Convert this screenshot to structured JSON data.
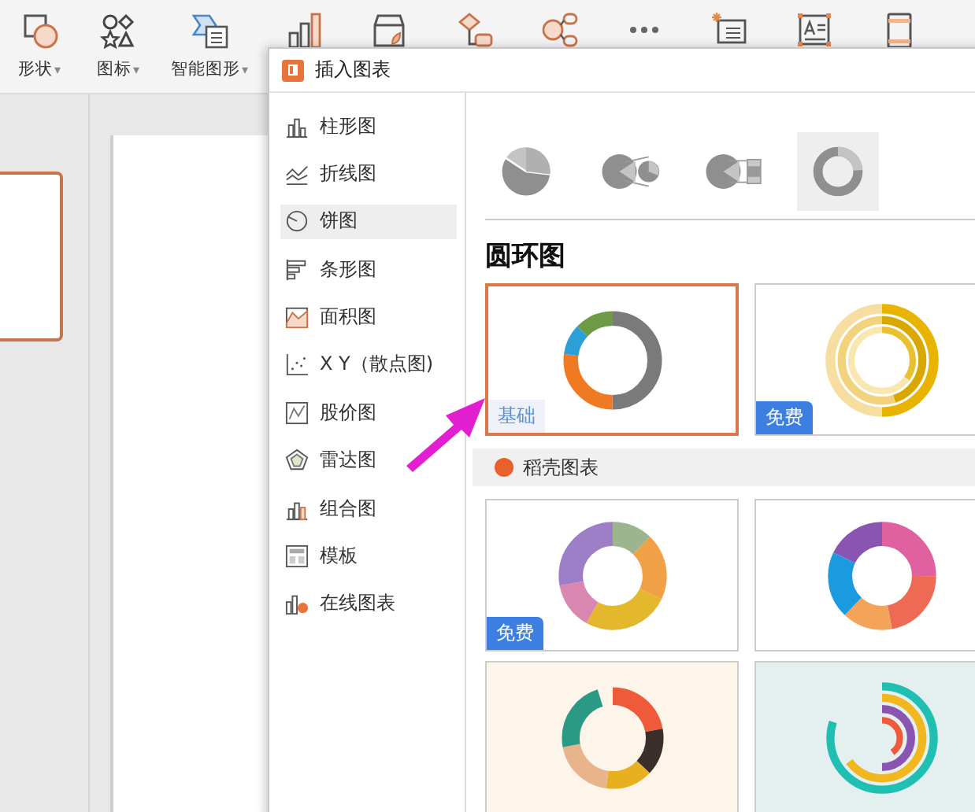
{
  "ribbon": {
    "tools": [
      {
        "kind": "shapes",
        "label": "形状",
        "dropdown": "▾"
      },
      {
        "kind": "icons",
        "label": "图标",
        "dropdown": "▾"
      },
      {
        "kind": "smart-art",
        "label": "智能图形",
        "dropdown": "▾"
      },
      {
        "kind": "chart"
      },
      {
        "kind": "store"
      },
      {
        "kind": "flow"
      },
      {
        "kind": "mind"
      },
      {
        "kind": "more"
      },
      {
        "kind": "note"
      },
      {
        "kind": "textbox"
      },
      {
        "kind": "page"
      }
    ]
  },
  "dialog": {
    "title": "插入图表",
    "nav": [
      {
        "kind": "column",
        "label": "柱形图",
        "selected": false
      },
      {
        "kind": "line",
        "label": "折线图",
        "selected": false
      },
      {
        "kind": "pie",
        "label": "饼图",
        "selected": true
      },
      {
        "kind": "bar",
        "label": "条形图",
        "selected": false
      },
      {
        "kind": "area",
        "label": "面积图",
        "selected": false
      },
      {
        "kind": "scatter",
        "label": "X Y（散点图)",
        "selected": false
      },
      {
        "kind": "stock",
        "label": "股价图",
        "selected": false
      },
      {
        "kind": "radar",
        "label": "雷达图",
        "selected": false
      },
      {
        "kind": "combo",
        "label": "组合图",
        "selected": false
      },
      {
        "kind": "template",
        "label": "模板",
        "selected": false
      },
      {
        "kind": "online",
        "label": "在线图表",
        "selected": false
      }
    ],
    "subtypes": [
      {
        "kind": "pie",
        "selected": false
      },
      {
        "kind": "pie-of-pie",
        "selected": false
      },
      {
        "kind": "bar-of-pie",
        "selected": false
      },
      {
        "kind": "doughnut",
        "selected": true
      }
    ],
    "heading": "圆环图",
    "cards": [
      {
        "kind": "basic-donut",
        "badge": {
          "text": "基础",
          "kind": "basic"
        },
        "selected": true
      },
      {
        "kind": "gold-rings",
        "badge": {
          "text": "免费",
          "kind": "free"
        },
        "selected": false
      }
    ],
    "section": "稻壳图表",
    "templates": [
      {
        "kind": "pastel-donut",
        "badge": {
          "text": "免费",
          "kind": "free"
        },
        "selected": false
      },
      {
        "kind": "bright-donut",
        "selected": false
      },
      {
        "kind": "warm-donut",
        "selected": false
      },
      {
        "kind": "radial-bars",
        "selected": false
      }
    ]
  }
}
